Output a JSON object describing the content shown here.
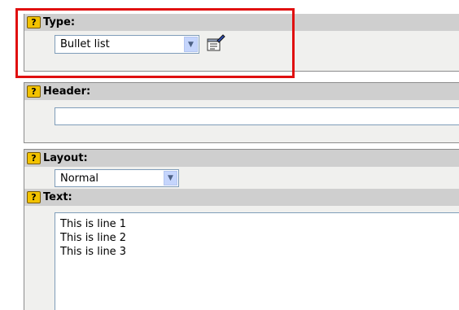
{
  "type_section": {
    "label": "Type:",
    "help_glyph": "?",
    "selected": "Bullet list",
    "dropdown_arrow": "▼",
    "edit_icon": "edit-properties-icon"
  },
  "header_section": {
    "label": "Header:",
    "help_glyph": "?",
    "value": ""
  },
  "layout_section": {
    "label": "Layout:",
    "help_glyph": "?",
    "selected": "Normal",
    "dropdown_arrow": "▼"
  },
  "text_section": {
    "label": "Text:",
    "help_glyph": "?",
    "lines": [
      "This is line 1",
      "This is line 2",
      "This is line 3"
    ]
  },
  "colors": {
    "highlight": "#e01010",
    "header_bar": "#cfcfcf",
    "help_icon": "#f2c200"
  }
}
